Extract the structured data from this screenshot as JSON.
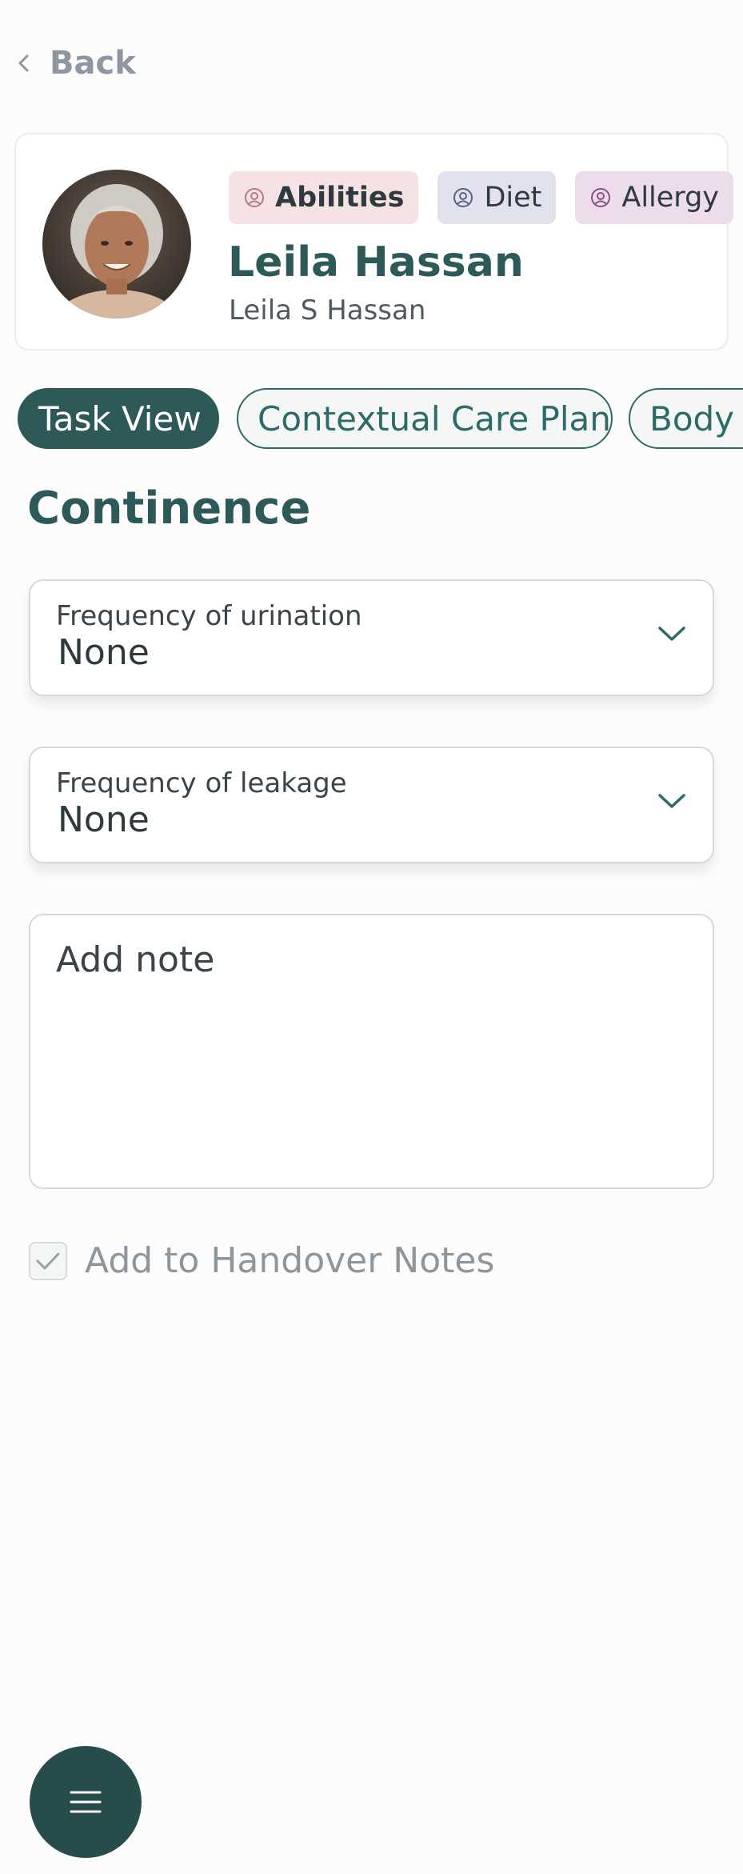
{
  "nav": {
    "back_label": "Back"
  },
  "profile": {
    "badges": [
      {
        "label": "Abilities",
        "icon": "user-circle-icon",
        "color": "#f4e2e4"
      },
      {
        "label": "Diet",
        "icon": "user-circle-icon",
        "color": "#e2e2ee"
      },
      {
        "label": "Allergy",
        "icon": "user-circle-icon",
        "color": "#ecdcec"
      }
    ],
    "name": "Leila Hassan",
    "full_name": "Leila S Hassan"
  },
  "tabs": [
    {
      "label": "Task View",
      "active": true
    },
    {
      "label": "Contextual Care Plan",
      "active": false
    },
    {
      "label": "Body",
      "active": false
    }
  ],
  "section": {
    "title": "Continence"
  },
  "fields": {
    "urination": {
      "label": "Frequency of urination",
      "value": "None"
    },
    "leakage": {
      "label": "Frequency of leakage",
      "value": "None"
    }
  },
  "note": {
    "placeholder": "Add note"
  },
  "handover": {
    "label": "Add to Handover Notes",
    "checked": true
  },
  "fab": {
    "icon": "menu-icon"
  },
  "colors": {
    "primary": "#2d5a58",
    "fab": "#264c4c",
    "background": "#fcfcfd"
  }
}
